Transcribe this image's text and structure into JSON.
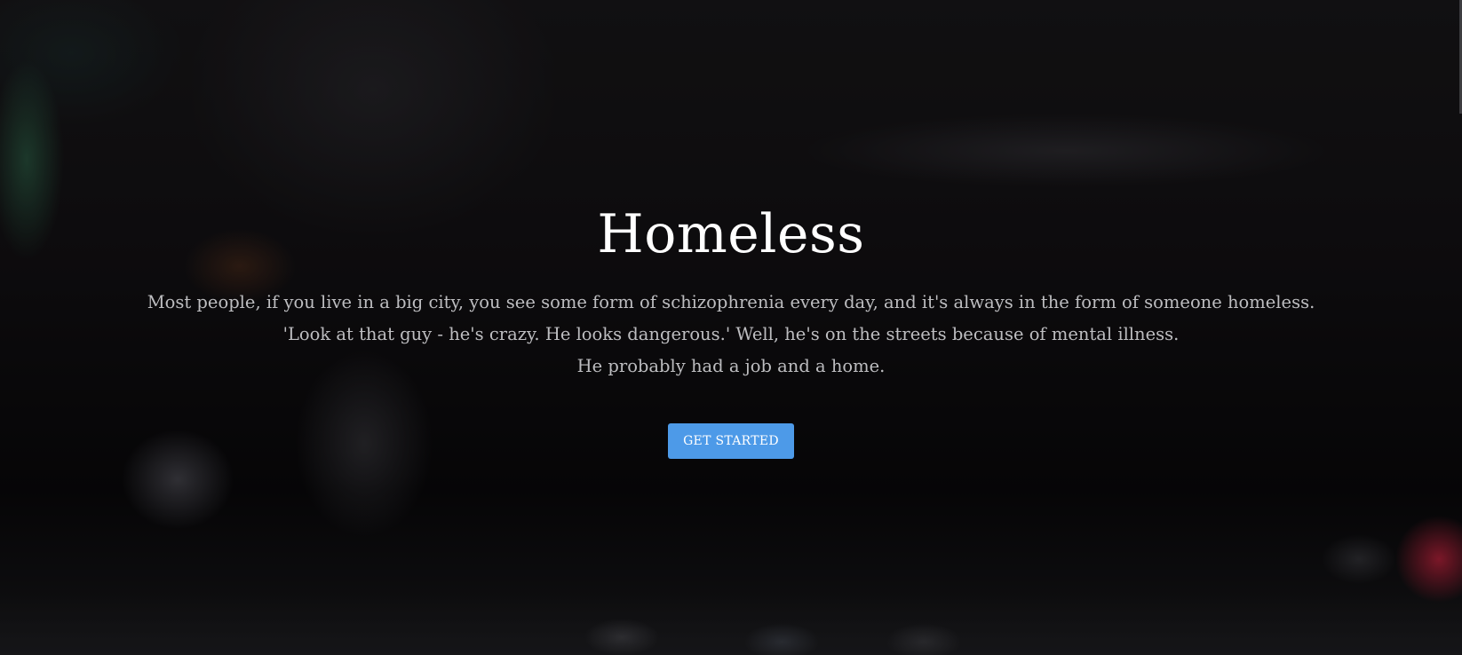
{
  "hero": {
    "title": "Homeless",
    "lead_lines": [
      "Most people, if you live in a big city, you see some form of schizophrenia every day, and it's always in the form of someone homeless.",
      "'Look at that guy - he's crazy. He looks dangerous.' Well, he's on the streets because of mental illness.",
      "He probably had a job and a home."
    ],
    "cta_label": "GET STARTED"
  },
  "colors": {
    "cta_background": "#4d9ae8",
    "title_text": "#ffffff",
    "lead_text": "#bdbdc0"
  }
}
